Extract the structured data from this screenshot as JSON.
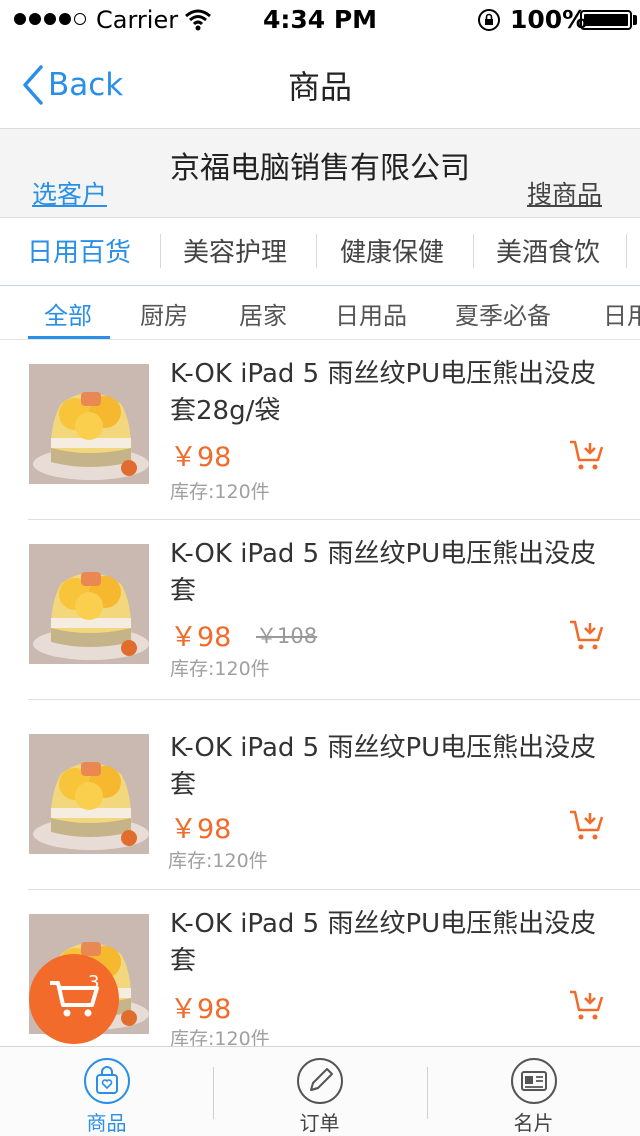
{
  "status_bar": {
    "carrier": "Carrier",
    "time": "4:34 PM",
    "battery": "100%",
    "signal_icon": "signal-dots-icon",
    "wifi_icon": "wifi-icon",
    "lock_icon": "rotation-lock-icon",
    "battery_icon": "battery-icon"
  },
  "nav": {
    "back_label": "Back",
    "title": "商品"
  },
  "company": {
    "name": "京福电脑销售有限公司",
    "pick_customer": "选客户",
    "search_goods": "搜商品"
  },
  "category_tabs": [
    {
      "label": "日用百货",
      "active": true
    },
    {
      "label": "美容护理",
      "active": false
    },
    {
      "label": "健康保健",
      "active": false
    },
    {
      "label": "美酒食饮",
      "active": false
    }
  ],
  "sub_tabs": [
    {
      "label": "全部",
      "active": true
    },
    {
      "label": "厨房",
      "active": false
    },
    {
      "label": "居家",
      "active": false
    },
    {
      "label": "日用品",
      "active": false
    },
    {
      "label": "夏季必备",
      "active": false
    },
    {
      "label": "日用",
      "active": false
    }
  ],
  "products": [
    {
      "title": "K-OK iPad 5 雨丝纹PU电压熊出没皮套28g/袋",
      "price": "￥98",
      "old_price": "",
      "stock": "库存:120件"
    },
    {
      "title": "K-OK iPad 5 雨丝纹PU电压熊出没皮套",
      "price": "￥98",
      "old_price": "￥108",
      "stock": "库存:120件"
    },
    {
      "title": "K-OK iPad 5 雨丝纹PU电压熊出没皮套",
      "price": "￥98",
      "old_price": "",
      "stock": "库存:120件"
    },
    {
      "title": "K-OK iPad 5 雨丝纹PU电压熊出没皮套",
      "price": "￥98",
      "old_price": "",
      "stock": "库存:120件"
    }
  ],
  "cart_fab": {
    "count": "3",
    "icon": "shopping-cart-icon"
  },
  "tab_bar": [
    {
      "label": "商品",
      "icon": "shopping-bag-icon",
      "active": true
    },
    {
      "label": "订单",
      "icon": "pencil-icon",
      "active": false
    },
    {
      "label": "名片",
      "icon": "business-card-icon",
      "active": false
    }
  ],
  "colors": {
    "accent": "#2a8fe6",
    "price": "#f26b2a",
    "fab": "#f26b2a"
  }
}
